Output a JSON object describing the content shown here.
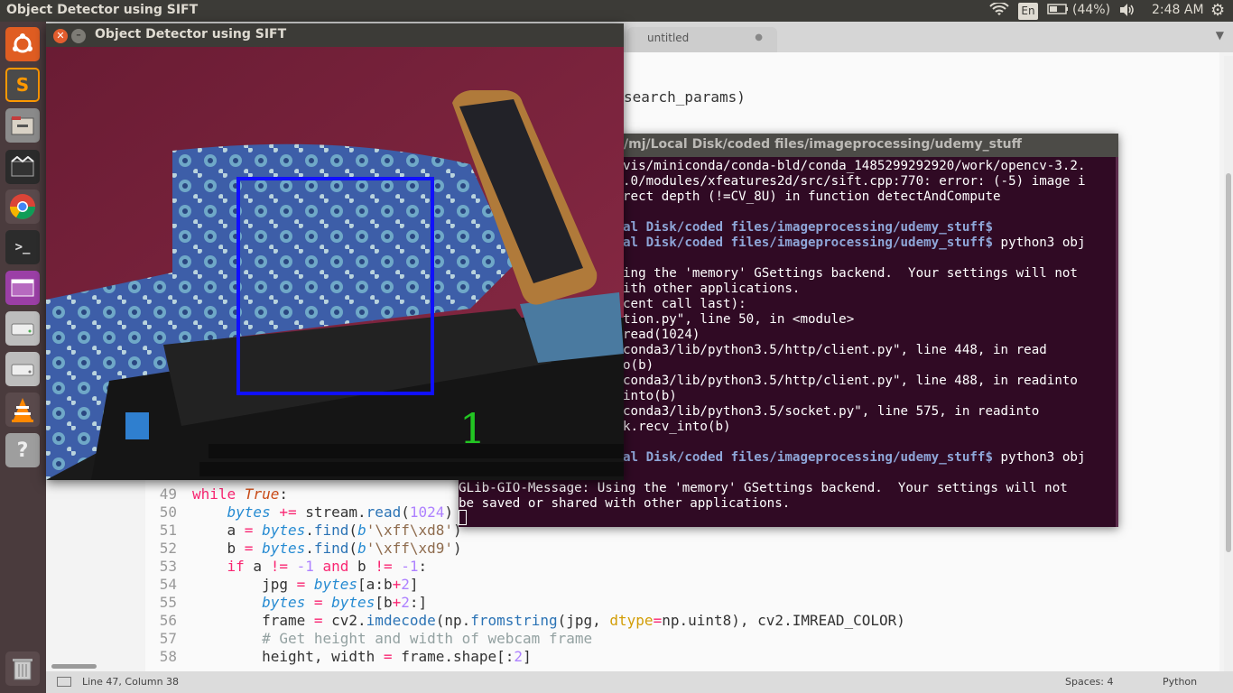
{
  "top_panel": {
    "app_title": "Object Detector using SIFT",
    "language": "En",
    "battery": "(44%)",
    "time": "2:48 AM"
  },
  "launcher": {
    "items": [
      "ubuntu-dash",
      "sublime-text",
      "file-manager",
      "video-editor",
      "chrome",
      "terminal",
      "app-purple",
      "disk-1",
      "disk-2",
      "vlc",
      "help"
    ],
    "trash": "trash"
  },
  "editor": {
    "tab_label": "untitled",
    "visible_fragments": {
      "search_params": "search_params)",
      "fragment_method": "thod"
    },
    "status": {
      "position": "Line 47, Column 38",
      "spaces": "Spaces: 4",
      "syntax": "Python"
    },
    "code_lines": [
      {
        "num": "49",
        "text": "while True:"
      },
      {
        "num": "50",
        "text": "    bytes += stream.read(1024)"
      },
      {
        "num": "51",
        "text": "    a = bytes.find(b'\\xff\\xd8')"
      },
      {
        "num": "52",
        "text": "    b = bytes.find(b'\\xff\\xd9')"
      },
      {
        "num": "53",
        "text": "    if a != -1 and b != -1:"
      },
      {
        "num": "54",
        "text": "        jpg = bytes[a:b+2]"
      },
      {
        "num": "55",
        "text": "        bytes = bytes[b+2:]"
      },
      {
        "num": "56",
        "text": "        frame = cv2.imdecode(np.fromstring(jpg, dtype=np.uint8), cv2.IMREAD_COLOR)"
      },
      {
        "num": "57",
        "text": "        # Get height and width of webcam frame"
      },
      {
        "num": "58",
        "text": "        height, width = frame.shape[:2]"
      },
      {
        "num": "59",
        "text": ""
      }
    ]
  },
  "terminal": {
    "title": "/mj/Local Disk/coded files/imageprocessing/udemy_stuff",
    "lines": [
      {
        "text": "vis/miniconda/conda-bld/conda_1485299292920/work/opencv-3.2.",
        "style": "normal"
      },
      {
        "text": ".0/modules/xfeatures2d/src/sift.cpp:770: error: (-5) image i",
        "style": "normal"
      },
      {
        "text": "rect depth (!=CV_8U) in function detectAndCompute",
        "style": "normal"
      },
      {
        "text": "",
        "style": "normal"
      },
      {
        "text": "al Disk/coded files/imageprocessing/udemy_stuff$",
        "style": "prompt",
        "cmd": ""
      },
      {
        "text": "al Disk/coded files/imageprocessing/udemy_stuff$",
        "style": "prompt",
        "cmd": " python3 obj"
      },
      {
        "text": "",
        "style": "normal"
      },
      {
        "text": "ing the 'memory' GSettings backend.  Your settings will not",
        "style": "normal"
      },
      {
        "text": "ith other applications.",
        "style": "normal"
      },
      {
        "text": "cent call last):",
        "style": "normal"
      },
      {
        "text": "tion.py\", line 50, in <module>",
        "style": "normal"
      },
      {
        "text": "read(1024)",
        "style": "normal"
      },
      {
        "text": "conda3/lib/python3.5/http/client.py\", line 448, in read",
        "style": "normal"
      },
      {
        "text": "o(b)",
        "style": "normal"
      },
      {
        "text": "conda3/lib/python3.5/http/client.py\", line 488, in readinto",
        "style": "normal"
      },
      {
        "text": "into(b)",
        "style": "normal"
      },
      {
        "text": "conda3/lib/python3.5/socket.py\", line 575, in readinto",
        "style": "normal"
      },
      {
        "text": "k.recv_into(b)",
        "style": "normal"
      },
      {
        "text": "",
        "style": "normal"
      },
      {
        "text": "al Disk/coded files/imageprocessing/udemy_stuff$",
        "style": "prompt",
        "cmd": " python3 obj"
      },
      {
        "text": "",
        "style": "normal"
      },
      {
        "text": "GLib-GIO-Message: Using the 'memory' GSettings backend.  Your settings will not",
        "style": "full"
      },
      {
        "text": "be saved or shared with other applications.",
        "style": "full"
      }
    ]
  },
  "sift_window": {
    "title": "Object Detector using SIFT",
    "match_count": "1",
    "colors": {
      "box": "#1010ff",
      "count": "#22c522"
    }
  }
}
